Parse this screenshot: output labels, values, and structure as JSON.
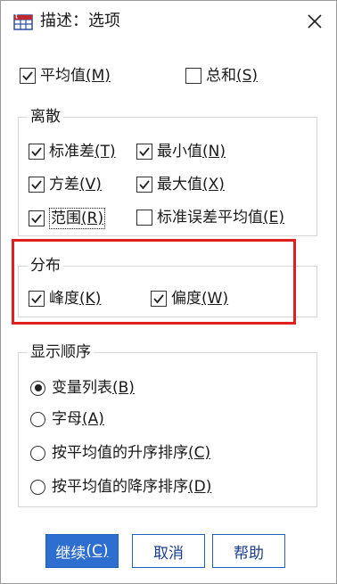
{
  "window": {
    "title": "描述：选项",
    "icon": "table-app-icon"
  },
  "top": {
    "mean": {
      "label": "平均值",
      "key": "(M)",
      "checked": true
    },
    "sum": {
      "label": "总和",
      "key": "(S)",
      "checked": false
    }
  },
  "dispersion": {
    "title": "离散",
    "std": {
      "label": "标准差",
      "key": "(T)",
      "checked": true
    },
    "variance": {
      "label": "方差",
      "key": "(V)",
      "checked": true
    },
    "range": {
      "label": "范围",
      "key": "(R)",
      "checked": true
    },
    "min": {
      "label": "最小值",
      "key": "(N)",
      "checked": true
    },
    "max": {
      "label": "最大值",
      "key": "(X)",
      "checked": true
    },
    "se_mean": {
      "label": "标准误差平均值",
      "key": "(E)",
      "checked": false
    }
  },
  "distribution": {
    "title": "分布",
    "kurtosis": {
      "label": "峰度",
      "key": "(K)",
      "checked": true
    },
    "skewness": {
      "label": "偏度",
      "key": "(W)",
      "checked": true
    }
  },
  "display_order": {
    "title": "显示顺序",
    "options": [
      {
        "label": "变量列表",
        "key": "(B)",
        "selected": true
      },
      {
        "label": "字母",
        "key": "(A)",
        "selected": false
      },
      {
        "label": "按平均值的升序排序",
        "key": "(C)",
        "selected": false
      },
      {
        "label": "按平均值的降序排序",
        "key": "(D)",
        "selected": false
      }
    ]
  },
  "buttons": {
    "continue": "继续",
    "continue_key": "(C)",
    "cancel": "取消",
    "help": "帮助"
  },
  "colors": {
    "highlight": "#e02020",
    "primary_button": "#2d6ed0",
    "button_border": "#1f5fbf"
  }
}
